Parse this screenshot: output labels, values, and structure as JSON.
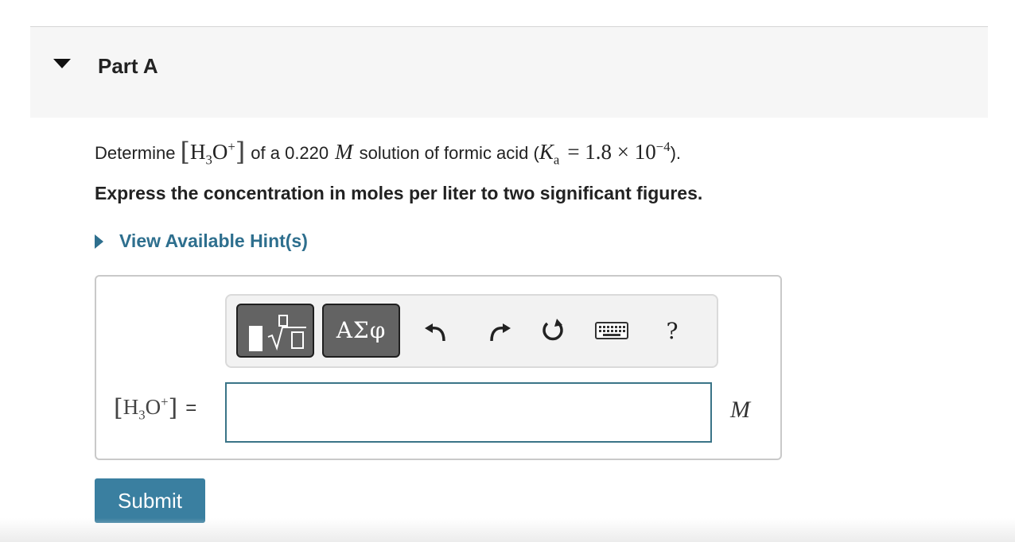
{
  "part": {
    "title": "Part A"
  },
  "question": {
    "prefix": "Determine",
    "species_base": "H",
    "species_sub": "3",
    "species_o": "O",
    "species_sup": "+",
    "middle": "of a 0.220",
    "molar_symbol": "M",
    "suffix": "solution of formic acid (",
    "ka_symbol": "K",
    "ka_sub": "a",
    "ka_value": "= 1.8 × 10",
    "ka_exponent": "−4",
    "closing": ")."
  },
  "instruction": "Express the concentration in moles per liter to two significant figures.",
  "hint": {
    "label": "View Available Hint(s)"
  },
  "toolbar": {
    "greek_label": "ΑΣφ",
    "help_label": "?",
    "icons": [
      "templates-icon",
      "greek-letters-icon",
      "undo-icon",
      "redo-icon",
      "reset-icon",
      "keyboard-icon",
      "help-icon"
    ]
  },
  "answer": {
    "label_base": "H",
    "label_sub": "3",
    "label_o": "O",
    "label_sup": "+",
    "equals": "=",
    "value": "",
    "unit": "M"
  },
  "submit_label": "Submit",
  "colors": {
    "link": "#2e6f8e",
    "submit": "#3a7fa0",
    "input_border": "#3a7487",
    "toolbar_dark_button": "#636363"
  }
}
